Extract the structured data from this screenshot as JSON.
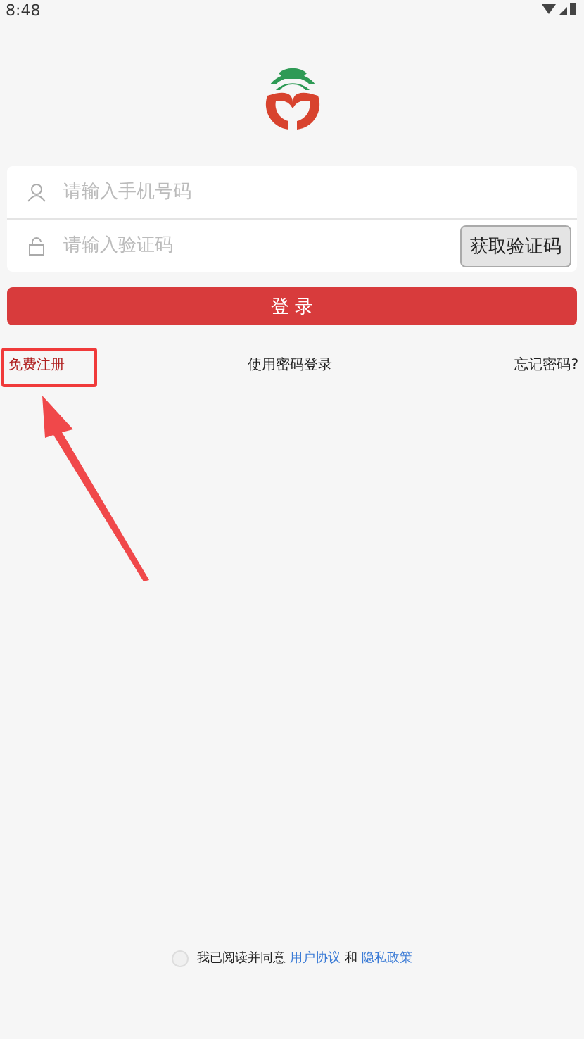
{
  "status_bar": {
    "time": "8:48"
  },
  "form": {
    "phone_field": {
      "placeholder": "请输入手机号码"
    },
    "code_field": {
      "placeholder": "请输入验证码"
    },
    "get_code_button": "获取验证码"
  },
  "login_button": "登 录",
  "links": [
    {
      "kind": "register",
      "label": "免费注册"
    },
    {
      "kind": "plain",
      "label": "使用密码登录"
    },
    {
      "kind": "plain",
      "label": "忘记密码?"
    }
  ],
  "agreement": {
    "checked": false,
    "text": "我已阅读并同意",
    "link_1": "用户协议",
    "joiner": "和",
    "link_2": "隐私政策"
  }
}
